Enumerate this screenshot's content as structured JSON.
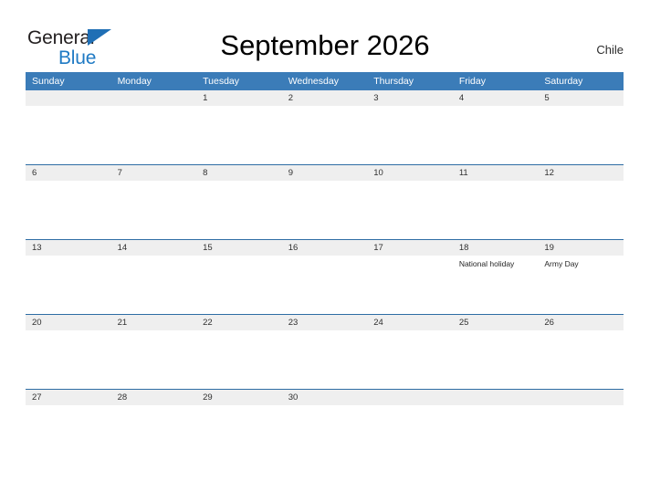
{
  "brand": {
    "name_part1": "General",
    "name_part2": "Blue",
    "triangle_color": "#1f6fb5",
    "blue_text_color": "#1f7ac4"
  },
  "header": {
    "title": "September 2026",
    "country": "Chile"
  },
  "theme": {
    "header_blue": "#3b7cb8",
    "row_divider_blue": "#2e6da4",
    "daynum_band_gray": "#efefef",
    "page_background": "#ffffff"
  },
  "calendar": {
    "month": "September",
    "year": "2026",
    "weekday_headers": [
      "Sunday",
      "Monday",
      "Tuesday",
      "Wednesday",
      "Thursday",
      "Friday",
      "Saturday"
    ],
    "weeks": [
      [
        {
          "day": "",
          "events": []
        },
        {
          "day": "",
          "events": []
        },
        {
          "day": "1",
          "events": []
        },
        {
          "day": "2",
          "events": []
        },
        {
          "day": "3",
          "events": []
        },
        {
          "day": "4",
          "events": []
        },
        {
          "day": "5",
          "events": []
        }
      ],
      [
        {
          "day": "6",
          "events": []
        },
        {
          "day": "7",
          "events": []
        },
        {
          "day": "8",
          "events": []
        },
        {
          "day": "9",
          "events": []
        },
        {
          "day": "10",
          "events": []
        },
        {
          "day": "11",
          "events": []
        },
        {
          "day": "12",
          "events": []
        }
      ],
      [
        {
          "day": "13",
          "events": []
        },
        {
          "day": "14",
          "events": []
        },
        {
          "day": "15",
          "events": []
        },
        {
          "day": "16",
          "events": []
        },
        {
          "day": "17",
          "events": []
        },
        {
          "day": "18",
          "events": [
            "National holiday"
          ]
        },
        {
          "day": "19",
          "events": [
            "Army Day"
          ]
        }
      ],
      [
        {
          "day": "20",
          "events": []
        },
        {
          "day": "21",
          "events": []
        },
        {
          "day": "22",
          "events": []
        },
        {
          "day": "23",
          "events": []
        },
        {
          "day": "24",
          "events": []
        },
        {
          "day": "25",
          "events": []
        },
        {
          "day": "26",
          "events": []
        }
      ],
      [
        {
          "day": "27",
          "events": []
        },
        {
          "day": "28",
          "events": []
        },
        {
          "day": "29",
          "events": []
        },
        {
          "day": "30",
          "events": []
        },
        {
          "day": "",
          "events": []
        },
        {
          "day": "",
          "events": []
        },
        {
          "day": "",
          "events": []
        }
      ]
    ]
  }
}
